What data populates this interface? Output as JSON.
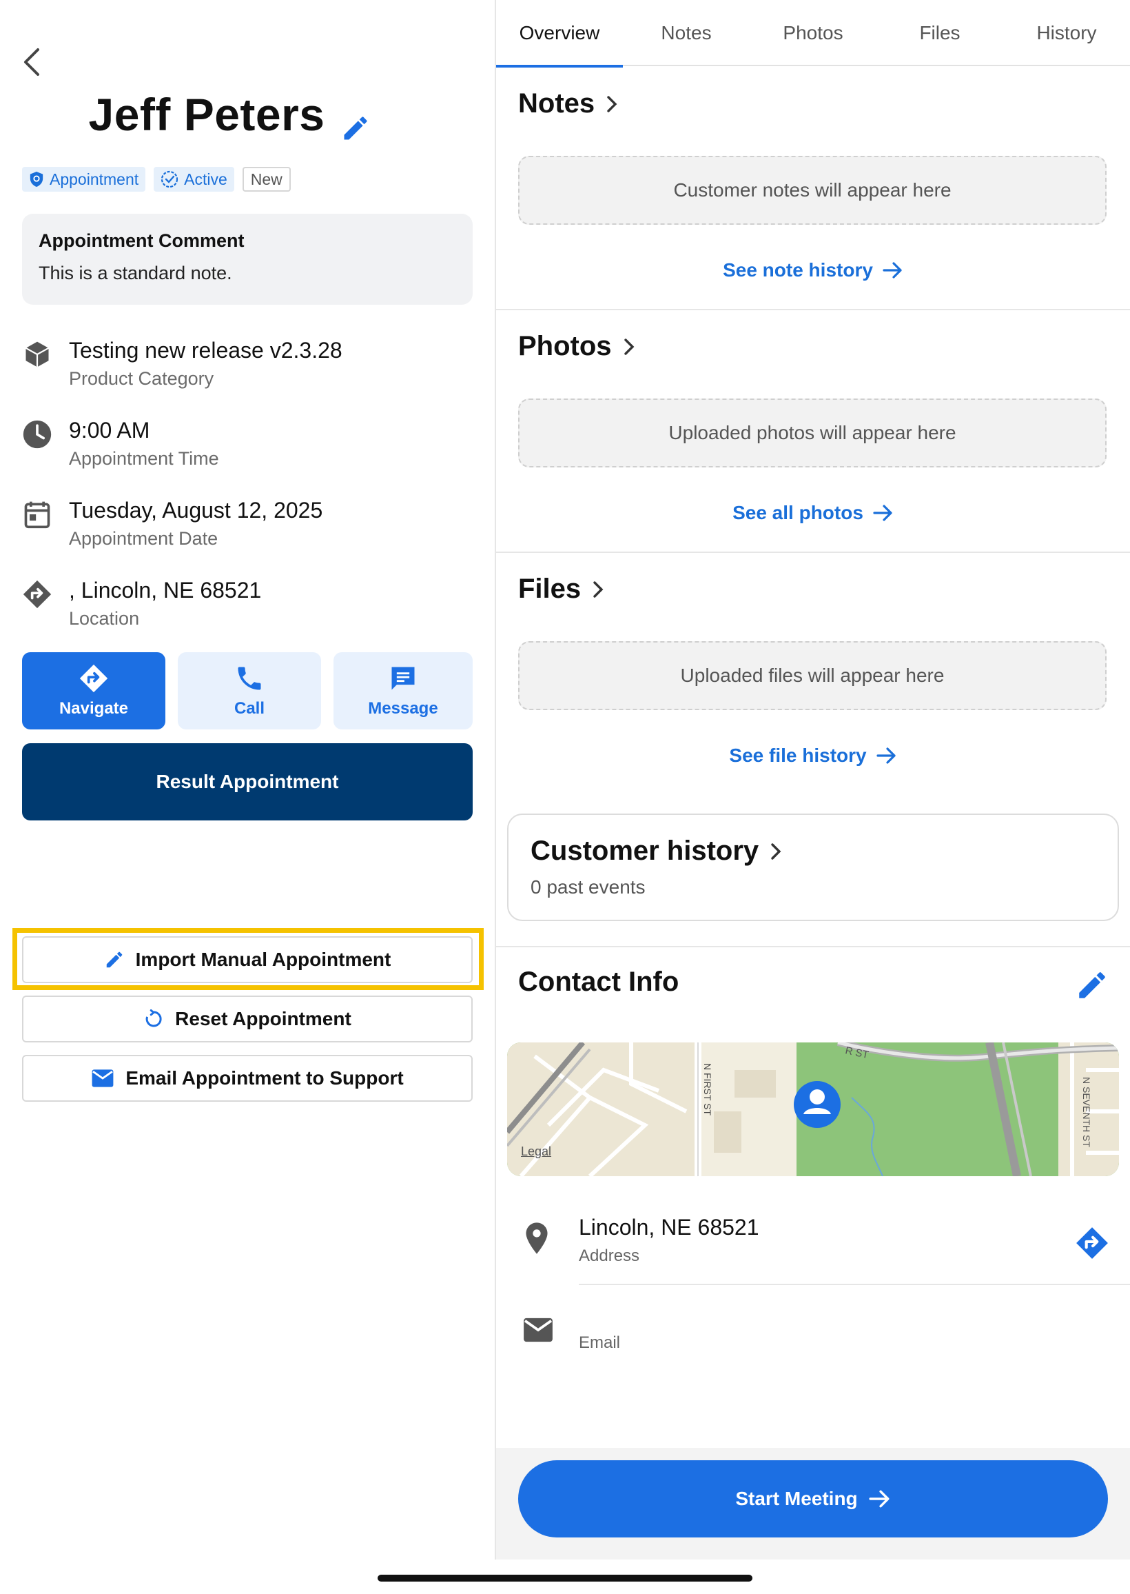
{
  "customer": {
    "name": "Jeff Peters",
    "badges": [
      "Appointment",
      "Active",
      "New"
    ]
  },
  "comment": {
    "title": "Appointment Comment",
    "body": "This is a standard note."
  },
  "details": [
    {
      "value": "Testing new release v2.3.28",
      "label": "Product Category",
      "icon": "cube-icon"
    },
    {
      "value": "9:00 AM",
      "label": "Appointment Time",
      "icon": "clock-icon"
    },
    {
      "value": "Tuesday, August 12, 2025",
      "label": "Appointment Date",
      "icon": "calendar-icon"
    },
    {
      "value": ", Lincoln, NE 68521",
      "label": "Location",
      "icon": "directions-icon"
    }
  ],
  "actions": {
    "navigate": "Navigate",
    "call": "Call",
    "message": "Message",
    "result": "Result Appointment",
    "import_manual": "Import Manual Appointment",
    "reset": "Reset Appointment",
    "email_support": "Email Appointment to Support"
  },
  "tabs": [
    "Overview",
    "Notes",
    "Photos",
    "Files",
    "History"
  ],
  "active_tab": "Overview",
  "sections": {
    "notes": {
      "title": "Notes",
      "placeholder": "Customer notes will appear here",
      "link": "See note history"
    },
    "photos": {
      "title": "Photos",
      "placeholder": "Uploaded photos will appear here",
      "link": "See all photos"
    },
    "files": {
      "title": "Files",
      "placeholder": "Uploaded files will appear here",
      "link": "See file history"
    }
  },
  "customer_history": {
    "title": "Customer history",
    "subtitle": "0 past events"
  },
  "contact": {
    "title": "Contact Info",
    "address_value": "Lincoln, NE 68521",
    "address_label": "Address",
    "email_label": "Email",
    "map_legal": "Legal",
    "map_labels": [
      "N FIRST ST",
      "N SEVENTH ST",
      "R ST"
    ]
  },
  "footer": {
    "start_meeting": "Start Meeting"
  },
  "colors": {
    "primary": "#1c6fe3",
    "navy": "#003a70",
    "highlight": "#f5c200"
  }
}
